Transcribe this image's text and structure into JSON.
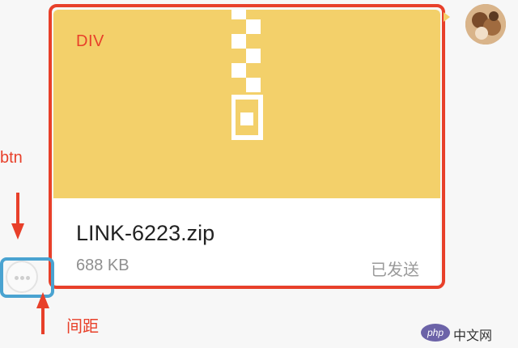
{
  "annotations": {
    "div_label": "DIV",
    "btn_label": "btn",
    "spacing_label": "间距"
  },
  "file": {
    "name": "LINK-6223.zip",
    "size": "688 KB",
    "status": "已发送"
  },
  "colors": {
    "preview_bg": "#f3d06a",
    "annotation_red": "#e8402a",
    "annotation_blue": "#4aa3d1"
  },
  "watermark": {
    "logo": "php",
    "text": "中文网"
  },
  "icons": {
    "zip": "zipper-icon",
    "more": "more-dots-icon"
  }
}
